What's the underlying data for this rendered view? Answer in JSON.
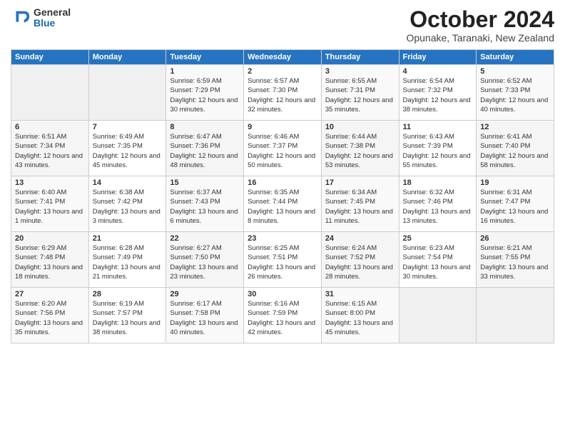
{
  "logo": {
    "general": "General",
    "blue": "Blue"
  },
  "title": "October 2024",
  "subtitle": "Opunake, Taranaki, New Zealand",
  "headers": [
    "Sunday",
    "Monday",
    "Tuesday",
    "Wednesday",
    "Thursday",
    "Friday",
    "Saturday"
  ],
  "weeks": [
    [
      {
        "day": "",
        "info": ""
      },
      {
        "day": "",
        "info": ""
      },
      {
        "day": "1",
        "info": "Sunrise: 6:59 AM\nSunset: 7:29 PM\nDaylight: 12 hours and 30 minutes."
      },
      {
        "day": "2",
        "info": "Sunrise: 6:57 AM\nSunset: 7:30 PM\nDaylight: 12 hours and 32 minutes."
      },
      {
        "day": "3",
        "info": "Sunrise: 6:55 AM\nSunset: 7:31 PM\nDaylight: 12 hours and 35 minutes."
      },
      {
        "day": "4",
        "info": "Sunrise: 6:54 AM\nSunset: 7:32 PM\nDaylight: 12 hours and 38 minutes."
      },
      {
        "day": "5",
        "info": "Sunrise: 6:52 AM\nSunset: 7:33 PM\nDaylight: 12 hours and 40 minutes."
      }
    ],
    [
      {
        "day": "6",
        "info": "Sunrise: 6:51 AM\nSunset: 7:34 PM\nDaylight: 12 hours and 43 minutes."
      },
      {
        "day": "7",
        "info": "Sunrise: 6:49 AM\nSunset: 7:35 PM\nDaylight: 12 hours and 45 minutes."
      },
      {
        "day": "8",
        "info": "Sunrise: 6:47 AM\nSunset: 7:36 PM\nDaylight: 12 hours and 48 minutes."
      },
      {
        "day": "9",
        "info": "Sunrise: 6:46 AM\nSunset: 7:37 PM\nDaylight: 12 hours and 50 minutes."
      },
      {
        "day": "10",
        "info": "Sunrise: 6:44 AM\nSunset: 7:38 PM\nDaylight: 12 hours and 53 minutes."
      },
      {
        "day": "11",
        "info": "Sunrise: 6:43 AM\nSunset: 7:39 PM\nDaylight: 12 hours and 55 minutes."
      },
      {
        "day": "12",
        "info": "Sunrise: 6:41 AM\nSunset: 7:40 PM\nDaylight: 12 hours and 58 minutes."
      }
    ],
    [
      {
        "day": "13",
        "info": "Sunrise: 6:40 AM\nSunset: 7:41 PM\nDaylight: 13 hours and 1 minute."
      },
      {
        "day": "14",
        "info": "Sunrise: 6:38 AM\nSunset: 7:42 PM\nDaylight: 13 hours and 3 minutes."
      },
      {
        "day": "15",
        "info": "Sunrise: 6:37 AM\nSunset: 7:43 PM\nDaylight: 13 hours and 6 minutes."
      },
      {
        "day": "16",
        "info": "Sunrise: 6:35 AM\nSunset: 7:44 PM\nDaylight: 13 hours and 8 minutes."
      },
      {
        "day": "17",
        "info": "Sunrise: 6:34 AM\nSunset: 7:45 PM\nDaylight: 13 hours and 11 minutes."
      },
      {
        "day": "18",
        "info": "Sunrise: 6:32 AM\nSunset: 7:46 PM\nDaylight: 13 hours and 13 minutes."
      },
      {
        "day": "19",
        "info": "Sunrise: 6:31 AM\nSunset: 7:47 PM\nDaylight: 13 hours and 16 minutes."
      }
    ],
    [
      {
        "day": "20",
        "info": "Sunrise: 6:29 AM\nSunset: 7:48 PM\nDaylight: 13 hours and 18 minutes."
      },
      {
        "day": "21",
        "info": "Sunrise: 6:28 AM\nSunset: 7:49 PM\nDaylight: 13 hours and 21 minutes."
      },
      {
        "day": "22",
        "info": "Sunrise: 6:27 AM\nSunset: 7:50 PM\nDaylight: 13 hours and 23 minutes."
      },
      {
        "day": "23",
        "info": "Sunrise: 6:25 AM\nSunset: 7:51 PM\nDaylight: 13 hours and 26 minutes."
      },
      {
        "day": "24",
        "info": "Sunrise: 6:24 AM\nSunset: 7:52 PM\nDaylight: 13 hours and 28 minutes."
      },
      {
        "day": "25",
        "info": "Sunrise: 6:23 AM\nSunset: 7:54 PM\nDaylight: 13 hours and 30 minutes."
      },
      {
        "day": "26",
        "info": "Sunrise: 6:21 AM\nSunset: 7:55 PM\nDaylight: 13 hours and 33 minutes."
      }
    ],
    [
      {
        "day": "27",
        "info": "Sunrise: 6:20 AM\nSunset: 7:56 PM\nDaylight: 13 hours and 35 minutes."
      },
      {
        "day": "28",
        "info": "Sunrise: 6:19 AM\nSunset: 7:57 PM\nDaylight: 13 hours and 38 minutes."
      },
      {
        "day": "29",
        "info": "Sunrise: 6:17 AM\nSunset: 7:58 PM\nDaylight: 13 hours and 40 minutes."
      },
      {
        "day": "30",
        "info": "Sunrise: 6:16 AM\nSunset: 7:59 PM\nDaylight: 13 hours and 42 minutes."
      },
      {
        "day": "31",
        "info": "Sunrise: 6:15 AM\nSunset: 8:00 PM\nDaylight: 13 hours and 45 minutes."
      },
      {
        "day": "",
        "info": ""
      },
      {
        "day": "",
        "info": ""
      }
    ]
  ]
}
